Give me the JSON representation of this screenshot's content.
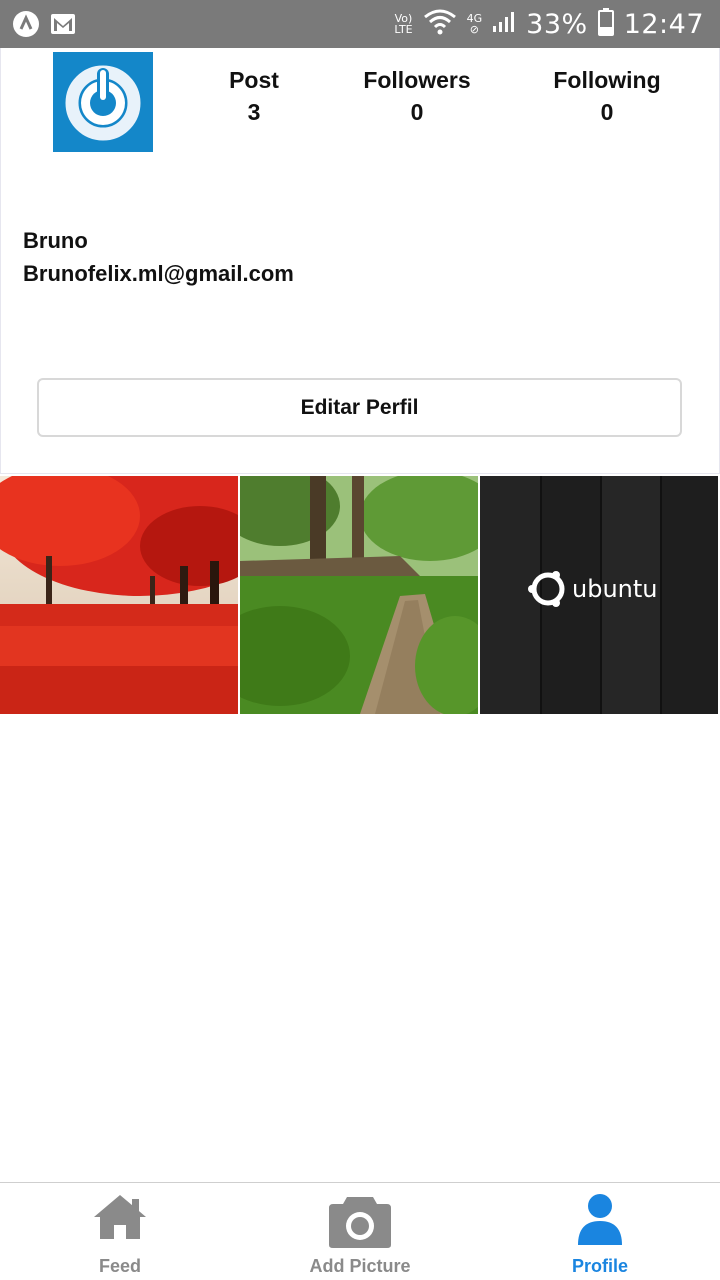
{
  "status_bar": {
    "battery": "33%",
    "time": "12:47",
    "network_top": "Vo)",
    "network_bottom": "LTE",
    "cell_label": "4G"
  },
  "profile": {
    "stats": [
      {
        "label": "Post",
        "value": "3"
      },
      {
        "label": "Followers",
        "value": "0"
      },
      {
        "label": "Following",
        "value": "0"
      }
    ],
    "name": "Bruno",
    "email": "Brunofelix.ml@gmail.com",
    "edit_button": "Editar Perfil"
  },
  "posts": [
    {
      "icon": "red-autumn-trees-photo"
    },
    {
      "icon": "green-forest-path-photo"
    },
    {
      "icon": "ubuntu-wallpaper-photo",
      "text": "ubuntu"
    }
  ],
  "nav": {
    "items": [
      {
        "label": "Feed",
        "icon": "home-icon"
      },
      {
        "label": "Add Picture",
        "icon": "camera-icon"
      },
      {
        "label": "Profile",
        "icon": "user-icon",
        "active": true
      }
    ],
    "active_color": "#1a85e0",
    "inactive_color": "#8a8a8a"
  }
}
